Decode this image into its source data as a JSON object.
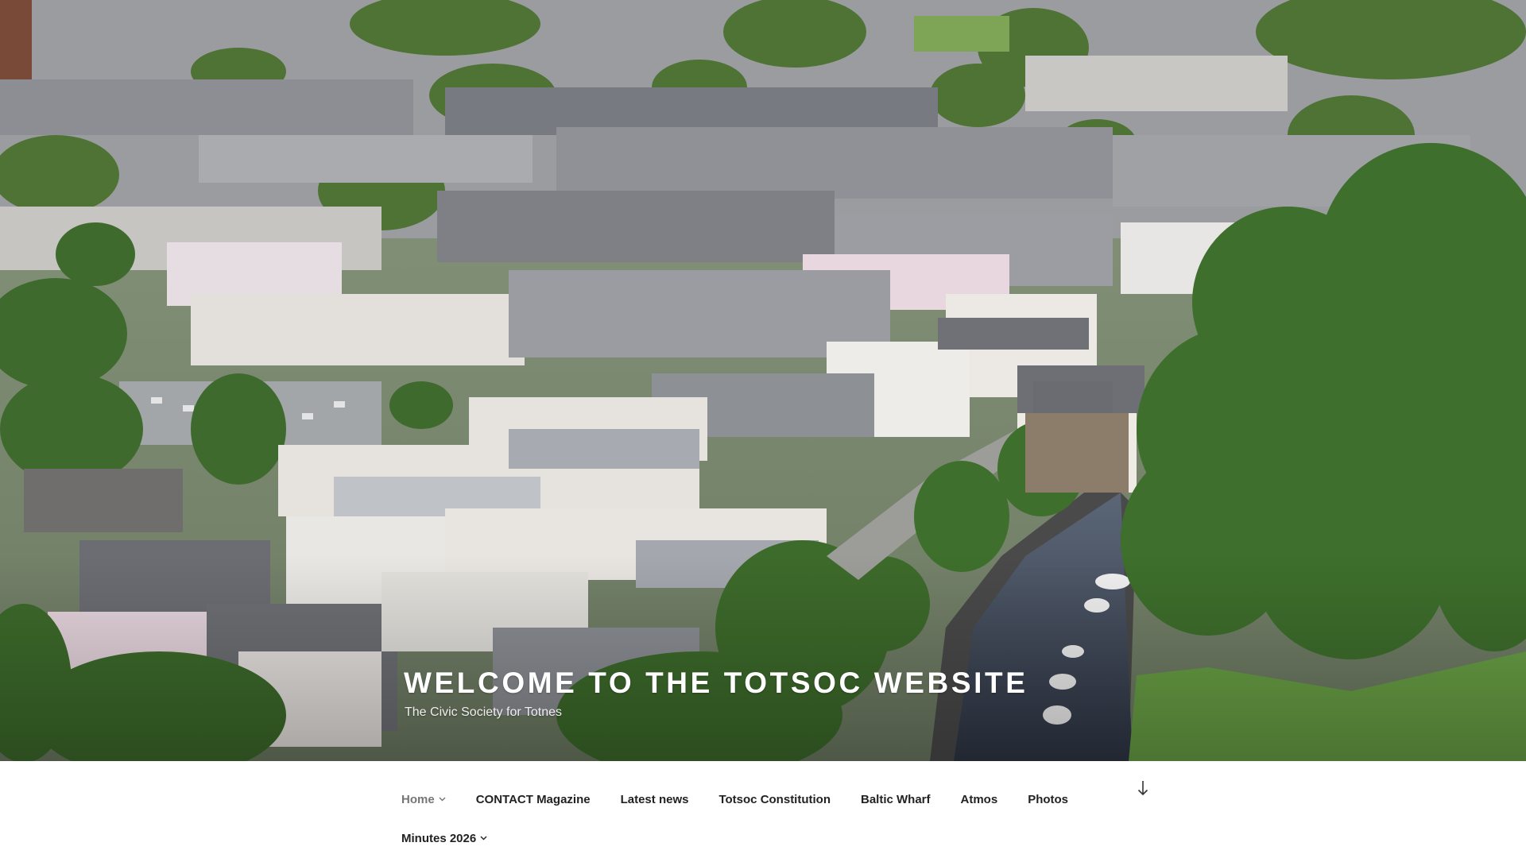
{
  "site": {
    "title": "WELCOME TO THE TOTSOC WEBSITE",
    "description": "The Civic Society for Totnes"
  },
  "header_image": {
    "subject": "aerial-town-view",
    "colors": {
      "foliage": "#4f7a3a",
      "roof": "#7d7f86",
      "wall": "#e9e6e1",
      "water": "#3b4454"
    }
  },
  "navigation": {
    "items": [
      {
        "label": "Home",
        "has_dropdown": true,
        "current": true
      },
      {
        "label": "CONTACT Magazine",
        "has_dropdown": false,
        "current": false
      },
      {
        "label": "Latest news",
        "has_dropdown": false,
        "current": false
      },
      {
        "label": "Totsoc Constitution",
        "has_dropdown": false,
        "current": false
      },
      {
        "label": "Baltic Wharf",
        "has_dropdown": false,
        "current": false
      },
      {
        "label": "Atmos",
        "has_dropdown": false,
        "current": false
      },
      {
        "label": "Photos",
        "has_dropdown": false,
        "current": false
      },
      {
        "label": "Minutes 2026",
        "has_dropdown": true,
        "current": false
      }
    ],
    "scroll_down_icon": "arrow-down-icon"
  },
  "colors": {
    "text": "#222222",
    "current_text": "#767676",
    "title": "#ffffff",
    "nav_background": "#ffffff"
  }
}
